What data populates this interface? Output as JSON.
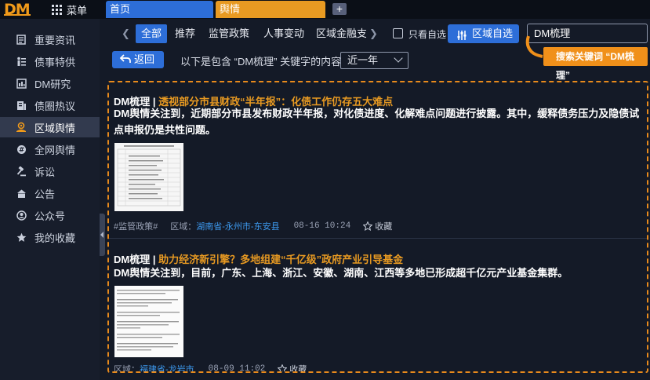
{
  "app": {
    "logo": "DM",
    "menu_label": "菜单"
  },
  "top_tabs": [
    {
      "label": "首页"
    },
    {
      "label": "舆情"
    }
  ],
  "add_tab_label": "+",
  "sidebar": {
    "items": [
      {
        "label": "重要资讯",
        "icon": "news-icon",
        "active": false
      },
      {
        "label": "债事特供",
        "icon": "bond-special-icon",
        "active": false
      },
      {
        "label": "DM研究",
        "icon": "research-icon",
        "active": false
      },
      {
        "label": "债圈热议",
        "icon": "discussion-icon",
        "active": false
      },
      {
        "label": "区域舆情",
        "icon": "region-opinion-icon",
        "active": true
      },
      {
        "label": "全网舆情",
        "icon": "global-opinion-icon",
        "active": false
      },
      {
        "label": "诉讼",
        "icon": "gavel-icon",
        "active": false
      },
      {
        "label": "公告",
        "icon": "announcement-icon",
        "active": false
      },
      {
        "label": "公众号",
        "icon": "wechat-account-icon",
        "active": false
      },
      {
        "label": "我的收藏",
        "icon": "star-icon",
        "active": false
      }
    ]
  },
  "category_tabs": [
    "全部",
    "推荐",
    "监管政策",
    "人事变动",
    "区域金融支"
  ],
  "active_category": "全部",
  "only_favorites_label": "只看自选",
  "region_watchlist_label": "区域自选",
  "search": {
    "value": "DM梳理"
  },
  "back_label": "返回",
  "results_description": "以下是包含 “DM梳理” 关键字的内容",
  "period": {
    "selected": "近一年"
  },
  "annotation": {
    "text": "搜索关键词 “DM梳理”"
  },
  "articles": [
    {
      "source": "DM梳理",
      "separator": " | ",
      "title": "透视部分市县财政“半年报”：化债工作仍存五大难点",
      "summary": "DM舆情关注到，近期部分市县发布财政半年报，对化债进度、化解难点问题进行披露。其中，缓释债务压力及隐债试点申报仍是共性问题。",
      "tag": "#监管政策#",
      "region_label": "区域：",
      "region": "湖南省-永州市-东安县",
      "date": "08-16 10:24",
      "favorite_label": "收藏"
    },
    {
      "source": "DM梳理",
      "separator": " | ",
      "title": "助力经济新引擎？多地组建“千亿级”政府产业引导基金",
      "summary": "DM舆情关注到，目前，广东、上海、浙江、安徽、湖南、江西等多地已形成超千亿元产业基金集群。",
      "tag": "",
      "region_label": "区域：",
      "region": "福建省-龙岩市",
      "date": "08-09 11:02",
      "favorite_label": "收藏"
    }
  ],
  "colors": {
    "accent_blue": "#2d6ed8",
    "accent_orange": "#e89a22",
    "region_link": "#3d9af0",
    "background": "#141a27"
  }
}
